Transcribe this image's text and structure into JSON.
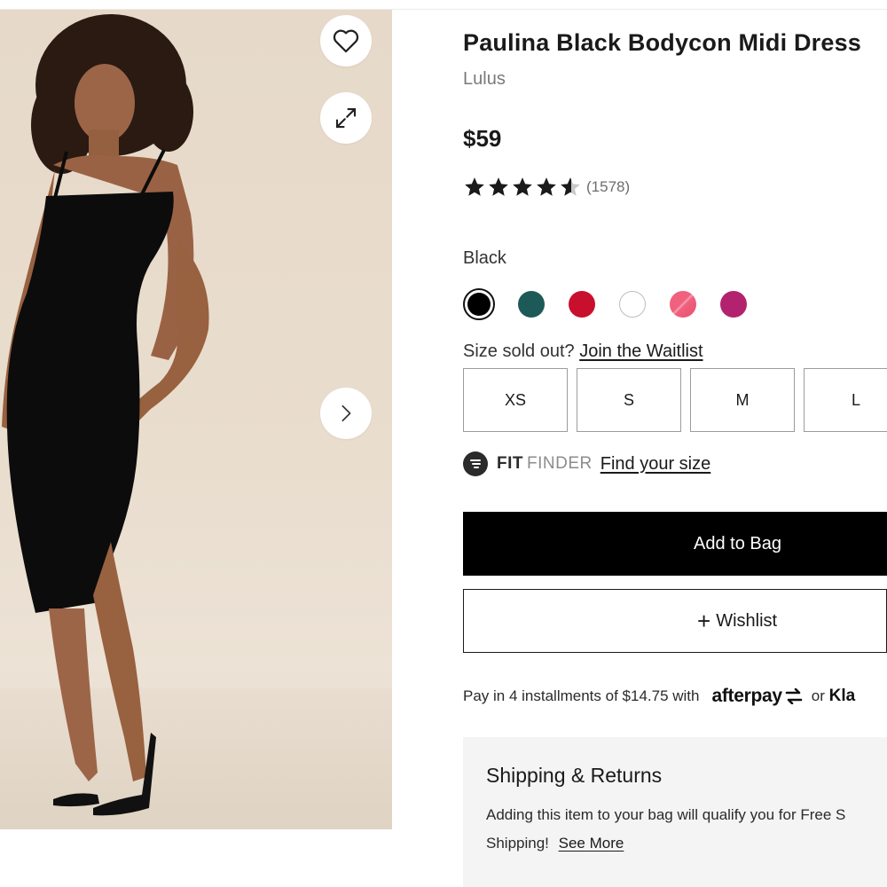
{
  "product": {
    "title": "Paulina Black Bodycon Midi Dress",
    "brand": "Lulus",
    "price": "$59",
    "rating": 4.5,
    "rating_count": "(1578)"
  },
  "gallery": {
    "icons": [
      "heart-icon",
      "expand-icon",
      "chevron-right-icon"
    ]
  },
  "colors": {
    "selected_label": "Black",
    "swatches": [
      {
        "name": "black",
        "hex": "#000000",
        "selected": true
      },
      {
        "name": "teal",
        "hex": "#1d5a57"
      },
      {
        "name": "red",
        "hex": "#c8102e"
      },
      {
        "name": "white",
        "hex": "#ffffff"
      },
      {
        "name": "pink",
        "hex": "#ee5a7e"
      },
      {
        "name": "magenta",
        "hex": "#b3226e"
      }
    ]
  },
  "sizes": {
    "note": "Size sold out?",
    "waitlist_link": "Join the Waitlist",
    "options": [
      "XS",
      "S",
      "M",
      "L"
    ]
  },
  "fit_finder": {
    "brand_a": "FIT",
    "brand_b": "FINDER",
    "link": "Find your size"
  },
  "actions": {
    "add_to_bag": "Add to Bag",
    "wishlist": "Wishlist"
  },
  "payments": {
    "installments_text": "Pay in 4 installments of $14.75 with",
    "afterpay": "afterpay",
    "or_text": "or",
    "klarna": "Kla"
  },
  "shipping": {
    "title": "Shipping & Returns",
    "line1": "Adding this item to your bag will qualify you for Free S",
    "line2": "Shipping!",
    "see_more": "See More"
  }
}
